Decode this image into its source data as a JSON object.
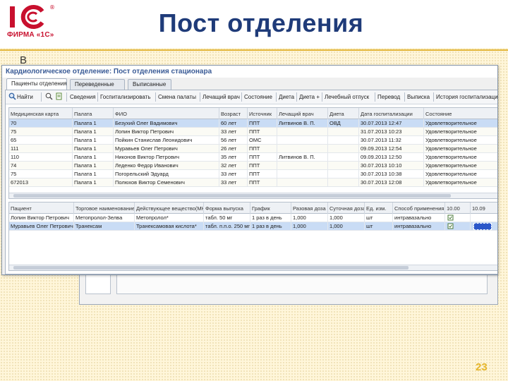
{
  "slide": {
    "title": "Пост отделения",
    "bullet_fragment": "В",
    "page_number": "23",
    "logo": {
      "mark": "1С",
      "caption": "ФИРМА «1С»",
      "registered": "®"
    },
    "colors": {
      "title": "#1f3b79",
      "brand_red": "#c8102e",
      "gold": "#e3b73c"
    }
  },
  "window": {
    "title": "Кардиологическое отделение: Пост отделения стационара",
    "tabs": [
      {
        "label": "Пациенты отделения",
        "active": true
      },
      {
        "label": "Переведенные",
        "active": false
      },
      {
        "label": "Выписанные",
        "active": false
      }
    ],
    "toolbar": [
      {
        "label": "Найти",
        "icon": "search-icon"
      },
      {
        "label": "",
        "icon": "zoom-icon"
      },
      {
        "label": "",
        "icon": "document-icon"
      },
      {
        "label": "Сведения",
        "icon": ""
      },
      {
        "label": "Госпитализировать",
        "icon": ""
      },
      {
        "label": "Смена палаты",
        "icon": ""
      },
      {
        "label": "Лечащий врач",
        "icon": ""
      },
      {
        "label": "Состояние",
        "icon": ""
      },
      {
        "label": "Диета",
        "icon": ""
      },
      {
        "label": "Диета +",
        "icon": ""
      },
      {
        "label": "Лечебный отпуск",
        "icon": ""
      },
      {
        "label": "Перевод",
        "icon": ""
      },
      {
        "label": "Выписка",
        "icon": ""
      },
      {
        "label": "История госпитализации",
        "icon": ""
      }
    ],
    "patients": {
      "columns": [
        "Медицинская карта",
        "Палата",
        "ФИО",
        "Возраст",
        "Источник",
        "Лечащий врач",
        "Диета",
        "Дата госпитализации",
        "Состояние"
      ],
      "rows": [
        [
          "70",
          "Палата 1",
          "Безухий Олег Вадимович",
          "60 лет",
          "ППТ",
          "Литвинов В. П.",
          "ОВД",
          "30.07.2013 12:47",
          "Удовлетворительное"
        ],
        [
          "75",
          "Палата 1",
          "Лопин Виктор Петрович",
          "33 лет",
          "ППТ",
          "",
          "",
          "31.07.2013 10:23",
          "Удовлетворительное"
        ],
        [
          "65",
          "Палата 1",
          "Пойкин Станислав Леонидович",
          "56 лет",
          "ОМС",
          "",
          "",
          "30.07.2013 11:32",
          "Удовлетворительное"
        ],
        [
          "111",
          "Палата 1",
          "Муравьев Олег Петрович",
          "26 лет",
          "ППТ",
          "",
          "",
          "09.09.2013 12:54",
          "Удовлетворительное"
        ],
        [
          "110",
          "Палата 1",
          "Никонов Виктор Петрович",
          "35 лет",
          "ППТ",
          "Литвинов В. П.",
          "",
          "09.09.2013 12:50",
          "Удовлетворительное"
        ],
        [
          "74",
          "Палата 1",
          "Леденко Федор Иванович",
          "32 лет",
          "ППТ",
          "",
          "",
          "30.07.2013 10:10",
          "Удовлетворительное"
        ],
        [
          "75",
          "Палата 1",
          "Погорельский Эдуард",
          "33 лет",
          "ППТ",
          "",
          "",
          "30.07.2013 10:38",
          "Удовлетворительное"
        ],
        [
          "672013",
          "Палата 1",
          "Полюхов Виктор Семенович",
          "33 лет",
          "ППТ",
          "",
          "",
          "30.07.2013 12:08",
          "Удовлетворительное"
        ]
      ],
      "selected_row": 0
    },
    "prescriptions": {
      "columns": [
        "Пациент",
        "Торговое наименование",
        "Действующее вещество(МНН)",
        "Форма выпуска",
        "График",
        "Разовая доза",
        "Суточная доза",
        "Ед. изм.",
        "Способ применения",
        "10.00",
        "10.09"
      ],
      "rows": [
        [
          "Лопин Виктор Петрович",
          "Метопролол-Зелва",
          "Метопролол*",
          "табл. 50 мг",
          "1 раз в день",
          "1,000",
          "1,000",
          "шт",
          "интравазально",
          "",
          ""
        ],
        [
          "Муравьев Олег Петрович",
          "Транексам",
          "Транексамовая кислота*",
          "табл. п.п.о. 250 мг",
          "1 раз в день",
          "1,000",
          "1,000",
          "шт",
          "интравазально",
          "",
          ""
        ]
      ],
      "selected_row": 1
    }
  }
}
